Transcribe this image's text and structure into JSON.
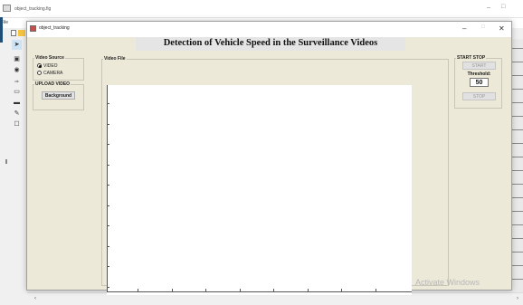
{
  "guide": {
    "title": "object_tracking.fig",
    "menu_file": "File",
    "minimize": "–",
    "maximize": "□",
    "scroll_left": "‹",
    "scroll_right": "›",
    "palette": [
      "➤",
      "▣",
      "◉",
      "ok",
      "▭",
      "▬",
      "✎",
      "☐"
    ]
  },
  "figure": {
    "title": "object_tracking",
    "minimize": "–",
    "maximize": "□",
    "close": "✕"
  },
  "app_title": "Detection of Vehicle Speed in the Surveillance Videos",
  "video_source": {
    "label": "Video Source",
    "options": [
      {
        "label": "VIDEO",
        "selected": true
      },
      {
        "label": "CAMERA",
        "selected": false
      }
    ]
  },
  "upload_video": {
    "label": "UPLOAD VIDEO",
    "background_button": "Background"
  },
  "video_file": {
    "label": "Video File"
  },
  "start_stop": {
    "label": "START STOP",
    "start_button": "START",
    "threshold_label": "Threshold:",
    "threshold_value": "50",
    "stop_button": "STOP"
  },
  "watermark": "Activate Windows"
}
